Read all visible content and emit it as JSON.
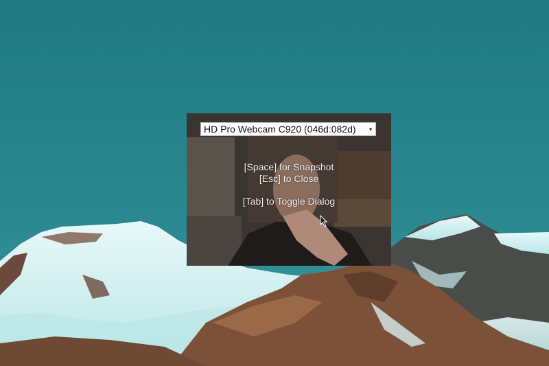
{
  "desktop": {
    "wallpaper": "mountain-landscape",
    "sky_color": "#257f86"
  },
  "webcam_dialog": {
    "camera_select": {
      "selected": "HD Pro Webcam C920 (046d:082d)",
      "arrow": "▾"
    },
    "instructions": {
      "snapshot": "[Space] for Snapshot",
      "close": "[Esc] to Close",
      "toggle": "[Tab] to Toggle Dialog"
    }
  }
}
